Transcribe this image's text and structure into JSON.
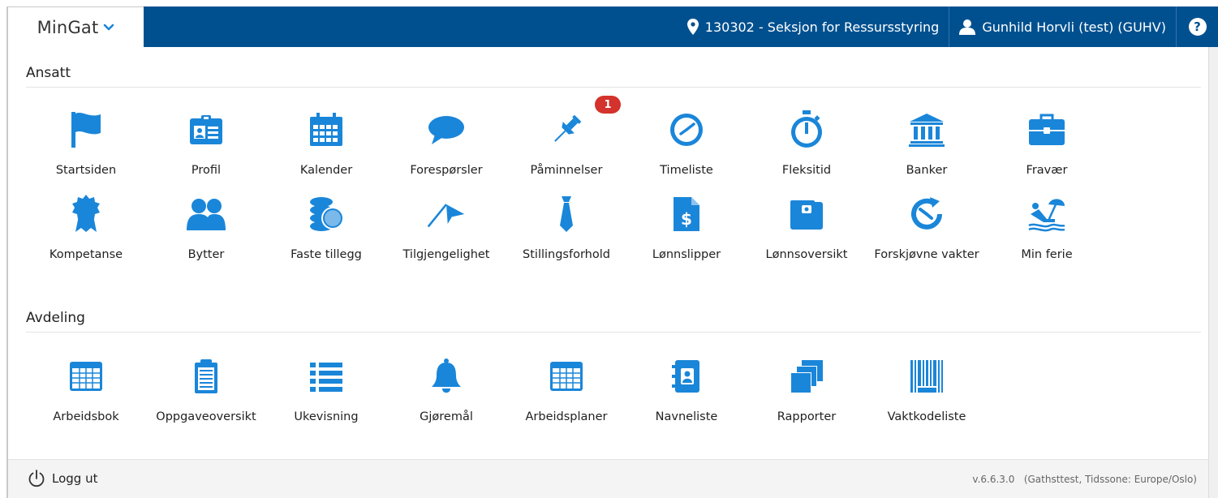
{
  "header": {
    "app_title": "MinGat",
    "department": "130302 - Seksjon for Ressursstyring",
    "user": "Gunhild Horvli (test) (GUHV)",
    "help_glyph": "?",
    "bar_color": "#00508f"
  },
  "ansatt": {
    "title": "Ansatt",
    "items": [
      {
        "label": "Startsiden",
        "icon": "flag-icon"
      },
      {
        "label": "Profil",
        "icon": "id-card-icon"
      },
      {
        "label": "Kalender",
        "icon": "calendar-icon"
      },
      {
        "label": "Forespørsler",
        "icon": "speech-bubble-icon"
      },
      {
        "label": "Påminnelser",
        "icon": "pushpin-icon",
        "badge": "1"
      },
      {
        "label": "Timeliste",
        "icon": "clock-icon"
      },
      {
        "label": "Fleksitid",
        "icon": "stopwatch-icon"
      },
      {
        "label": "Banker",
        "icon": "bank-icon"
      },
      {
        "label": "Fravær",
        "icon": "briefcase-icon"
      },
      {
        "label": "Kompetanse",
        "icon": "rosette-icon"
      },
      {
        "label": "Bytter",
        "icon": "users-icon"
      },
      {
        "label": "Faste tillegg",
        "icon": "coins-icon"
      },
      {
        "label": "Tilgjengelighet",
        "icon": "flag-pole-icon"
      },
      {
        "label": "Stillingsforhold",
        "icon": "tie-icon"
      },
      {
        "label": "Lønnslipper",
        "icon": "dollar-document-icon"
      },
      {
        "label": "Lønnsoversikt",
        "icon": "wallet-icon"
      },
      {
        "label": "Forskjøvne vakter",
        "icon": "rotate-clock-icon"
      },
      {
        "label": "Min ferie",
        "icon": "beach-chair-icon"
      }
    ]
  },
  "avdeling": {
    "title": "Avdeling",
    "items": [
      {
        "label": "Arbeidsbok",
        "icon": "spreadsheet-icon"
      },
      {
        "label": "Oppgaveoversikt",
        "icon": "clipboard-icon"
      },
      {
        "label": "Ukevisning",
        "icon": "list-icon"
      },
      {
        "label": "Gjøremål",
        "icon": "bell-icon"
      },
      {
        "label": "Arbeidsplaner",
        "icon": "table-icon"
      },
      {
        "label": "Navneliste",
        "icon": "address-book-icon"
      },
      {
        "label": "Rapporter",
        "icon": "stacked-pages-icon"
      },
      {
        "label": "Vaktkodeliste",
        "icon": "barcode-icon"
      }
    ]
  },
  "footer": {
    "logout_label": "Logg ut",
    "version": "v.6.6.3.0   (Gathsttest, Tidssone: Europe/Oslo)"
  },
  "colors": {
    "icon_blue": "#1a86d9",
    "badge_red": "#d4322c"
  }
}
